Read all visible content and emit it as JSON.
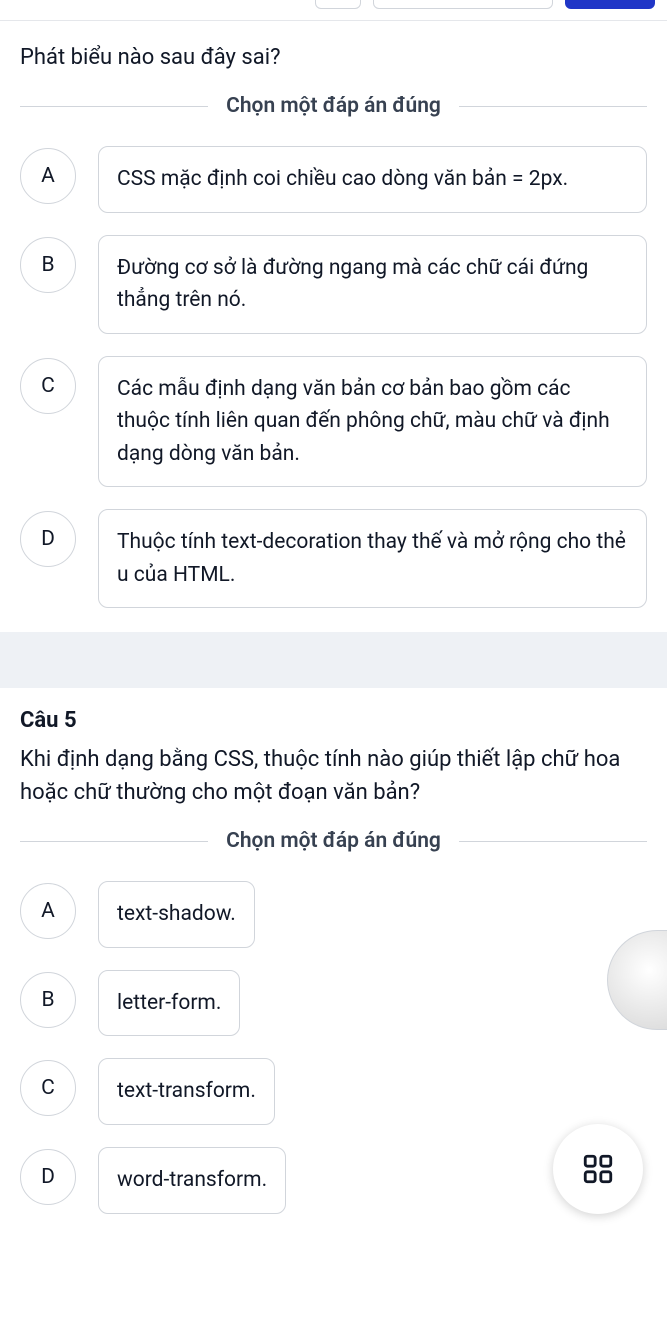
{
  "q4": {
    "prompt": "Phát biểu nào sau đây sai?",
    "instruction": "Chọn một đáp án đúng",
    "options": [
      {
        "letter": "A",
        "text": "CSS mặc định coi chiều cao dòng văn bản = 2px."
      },
      {
        "letter": "B",
        "text": "Đường cơ sở là đường ngang mà các chữ cái đứng thẳng trên nó."
      },
      {
        "letter": "C",
        "text": "Các mẫu định dạng văn bản cơ bản bao gồm các thuộc tính liên quan đến phông chữ, màu chữ và định dạng dòng văn bản."
      },
      {
        "letter": "D",
        "text": "Thuộc tính text-decoration thay thế và mở rộng cho thẻ u của HTML."
      }
    ]
  },
  "q5": {
    "label": "Câu 5",
    "prompt": "Khi định dạng bằng CSS, thuộc tính nào giúp thiết lập chữ hoa hoặc chữ thường cho một đoạn văn bản?",
    "instruction": "Chọn một đáp án đúng",
    "options": [
      {
        "letter": "A",
        "text": "text-shadow."
      },
      {
        "letter": "B",
        "text": "letter-form."
      },
      {
        "letter": "C",
        "text": "text-transform."
      },
      {
        "letter": "D",
        "text": "word-transform."
      }
    ]
  }
}
